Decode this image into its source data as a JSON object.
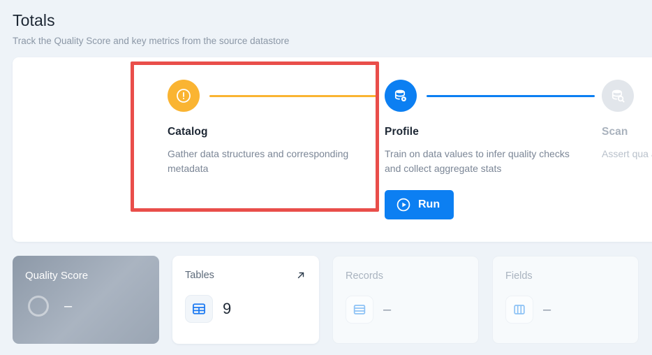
{
  "header": {
    "title": "Totals",
    "subtitle": "Track the Quality Score and key metrics from the source datastore"
  },
  "steps": [
    {
      "name": "Catalog",
      "description": "Gather data structures and corresponding metadata",
      "icon": "exclamation-circle-icon",
      "icon_color": "#fab432",
      "connector_color": "#fab432",
      "state": "highlighted",
      "action_label": null
    },
    {
      "name": "Profile",
      "description": "Train on data values to infer quality checks and collect aggregate stats",
      "icon": "database-profile-icon",
      "icon_color": "#0c7ff2",
      "connector_color": "#0c7ff2",
      "state": "active",
      "action_label": "Run"
    },
    {
      "name": "Scan",
      "description": "Assert qua anomalies",
      "icon": "database-scan-icon",
      "icon_color": "#e2e6eb",
      "connector_color": null,
      "state": "disabled",
      "action_label": null
    }
  ],
  "highlight": {
    "color": "#e94e4a"
  },
  "metrics": [
    {
      "label": "Quality Score",
      "value": "–",
      "icon": "ring-gauge-icon",
      "state": "score"
    },
    {
      "label": "Tables",
      "value": "9",
      "icon": "table-grid-icon",
      "state": "active",
      "link_icon": "arrow-up-right-icon"
    },
    {
      "label": "Records",
      "value": "–",
      "icon": "rows-icon",
      "state": "muted"
    },
    {
      "label": "Fields",
      "value": "–",
      "icon": "columns-icon",
      "state": "muted"
    }
  ]
}
